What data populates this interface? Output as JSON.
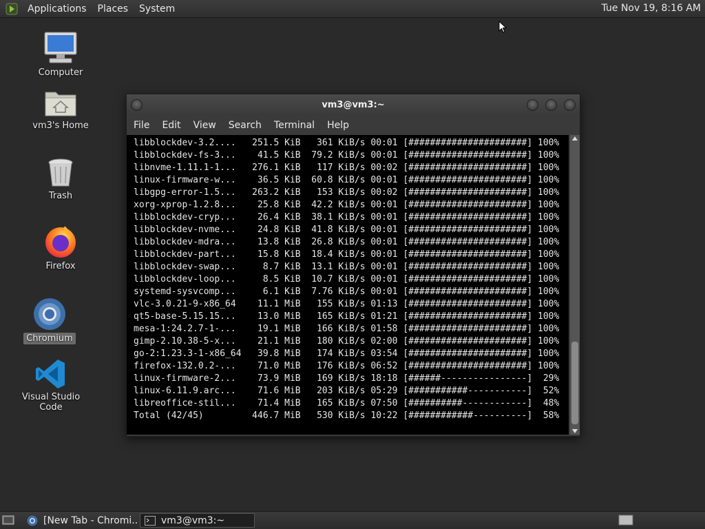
{
  "top_panel": {
    "menus": [
      "Applications",
      "Places",
      "System"
    ],
    "clock": "Tue Nov 19,  8:16 AM"
  },
  "desktop_icons": [
    {
      "label": "Computer"
    },
    {
      "label": "vm3's Home"
    },
    {
      "label": "Trash"
    },
    {
      "label": "Firefox"
    },
    {
      "label": "Chromium"
    },
    {
      "label": "Visual Studio Code"
    }
  ],
  "terminal": {
    "title": "vm3@vm3:~",
    "menus": [
      "File",
      "Edit",
      "View",
      "Search",
      "Terminal",
      "Help"
    ],
    "lines": [
      "libblockdev-3.2....   251.5 KiB   361 KiB/s 00:01 [######################] 100%",
      "libblockdev-fs-3...    41.5 KiB  79.2 KiB/s 00:01 [######################] 100%",
      "libnvme-1.11.1-1...   276.1 KiB   117 KiB/s 00:02 [######################] 100%",
      "linux-firmware-w...    36.5 KiB  60.8 KiB/s 00:01 [######################] 100%",
      "libgpg-error-1.5...   263.2 KiB   153 KiB/s 00:02 [######################] 100%",
      "xorg-xprop-1.2.8...    25.8 KiB  42.2 KiB/s 00:01 [######################] 100%",
      "libblockdev-cryp...    26.4 KiB  38.1 KiB/s 00:01 [######################] 100%",
      "libblockdev-nvme...    24.8 KiB  41.8 KiB/s 00:01 [######################] 100%",
      "libblockdev-mdra...    13.8 KiB  26.8 KiB/s 00:01 [######################] 100%",
      "libblockdev-part...    15.8 KiB  18.4 KiB/s 00:01 [######################] 100%",
      "libblockdev-swap...     8.7 KiB  13.1 KiB/s 00:01 [######################] 100%",
      "libblockdev-loop...     8.5 KiB  10.7 KiB/s 00:01 [######################] 100%",
      "systemd-sysvcomp...     6.1 KiB  7.76 KiB/s 00:01 [######################] 100%",
      "vlc-3.0.21-9-x86_64    11.1 MiB   155 KiB/s 01:13 [######################] 100%",
      "qt5-base-5.15.15...    13.0 MiB   165 KiB/s 01:21 [######################] 100%",
      "mesa-1:24.2.7-1-...    19.1 MiB   166 KiB/s 01:58 [######################] 100%",
      "gimp-2.10.38-5-x...    21.1 MiB   180 KiB/s 02:00 [######################] 100%",
      "go-2:1.23.3-1-x86_64   39.8 MiB   174 KiB/s 03:54 [######################] 100%",
      "firefox-132.0.2-...    71.0 MiB   176 KiB/s 06:52 [######################] 100%",
      "linux-firmware-2...    73.9 MiB   169 KiB/s 18:18 [######----------------]  29%",
      "linux-6.11.9.arc...    71.6 MiB   203 KiB/s 05:29 [###########-----------]  52%",
      "libreoffice-stil...    71.4 MiB   165 KiB/s 07:50 [##########------------]  48%",
      "Total (42/45)         446.7 MiB   530 KiB/s 10:22 [############----------]  58%"
    ]
  },
  "taskbar": {
    "tasks": [
      {
        "label": "[New Tab - Chromi...",
        "active": false
      },
      {
        "label": "vm3@vm3:~",
        "active": true
      }
    ]
  }
}
